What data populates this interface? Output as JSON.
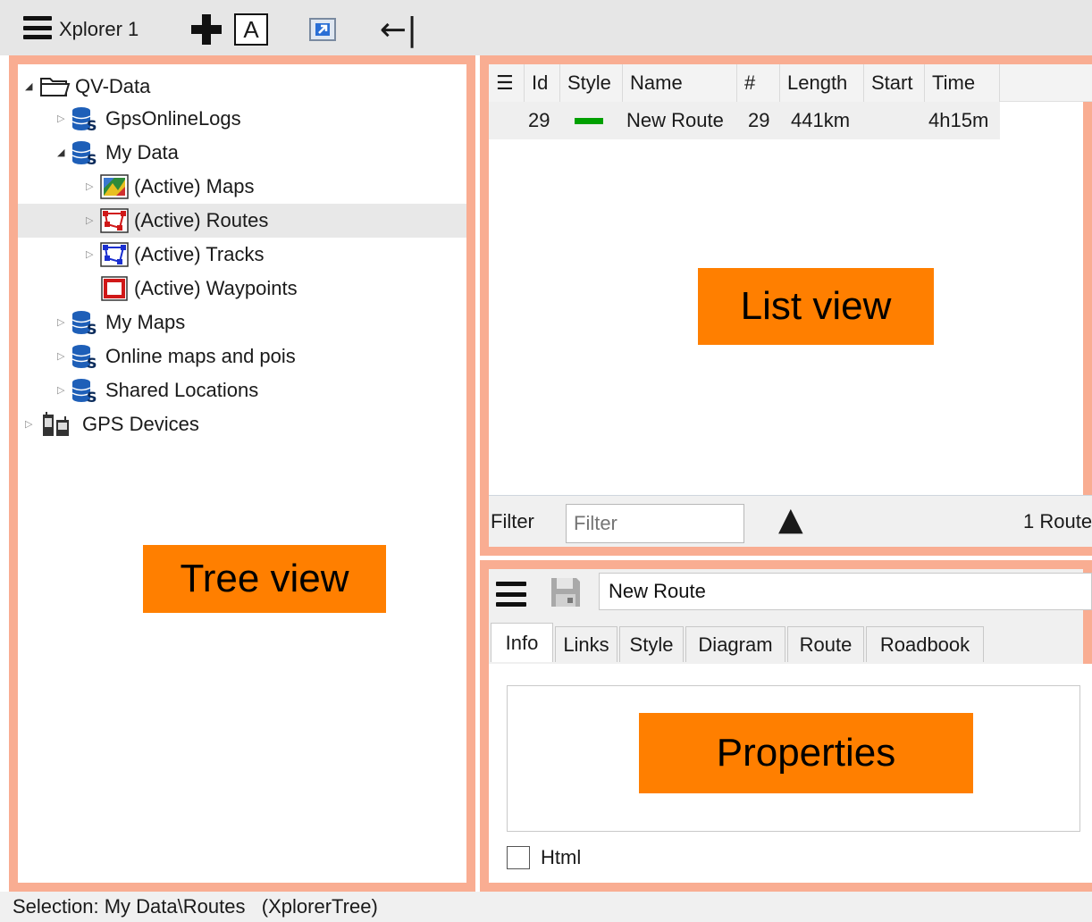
{
  "toolbar": {
    "title": "Xplorer 1",
    "add_icon": "plus-icon",
    "text_icon": "A",
    "shortcut_icon": "shortcut-icon",
    "back_icon": "←|"
  },
  "tree": {
    "root_label": "QV-Data",
    "items": [
      {
        "label": "GpsOnlineLogs"
      },
      {
        "label": "My Data"
      },
      {
        "label": "(Active) Maps"
      },
      {
        "label": "(Active) Routes"
      },
      {
        "label": "(Active) Tracks"
      },
      {
        "label": "(Active) Waypoints"
      },
      {
        "label": "My Maps"
      },
      {
        "label": "Online maps and pois"
      },
      {
        "label": "Shared Locations"
      },
      {
        "label": "GPS Devices"
      }
    ],
    "overlay_label": "Tree view"
  },
  "list": {
    "columns": [
      "Id",
      "Style",
      "Name",
      "#",
      "Length",
      "Start",
      "Time"
    ],
    "rows": [
      {
        "id": "29",
        "style_color": "#00a000",
        "name": "New Route",
        "count": "29",
        "length": "441km",
        "start": "",
        "time": "4h15m"
      }
    ],
    "overlay_label": "List view",
    "filter_label": "Filter",
    "filter_placeholder": "Filter",
    "sort_glyph": "▲",
    "count_text": "1 Route"
  },
  "properties": {
    "name_value": "New Route",
    "tabs": [
      "Info",
      "Links",
      "Style",
      "Diagram",
      "Route",
      "Roadbook"
    ],
    "active_tab": "Info",
    "overlay_label": "Properties",
    "html_label": "Html",
    "html_checked": false
  },
  "status": {
    "text": "Selection: My Data\\Routes   (XplorerTree)"
  },
  "colors": {
    "region_border": "#f9ad92",
    "overlay_bg": "#ff7f00",
    "db_icon": "#1e5fb8"
  }
}
